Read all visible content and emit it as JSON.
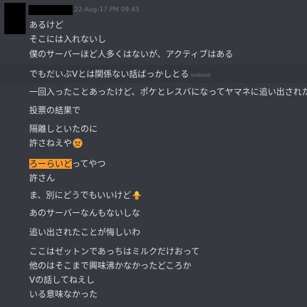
{
  "message": {
    "timestamp": "22-Aug-17 PM 09:45",
    "lines": [
      "あるけど",
      "そこには入れないし",
      "僕のサーバーほど人多くはないが、アクティブはある",
      "でもだいぶVとは関係ない話ばっかしとる",
      "一回入ったことあったけど、ポケとレスバになってヤマネに追い出された",
      "投票の結果で",
      "隔離しといたのに",
      "許さねえや",
      "ろーらいど",
      "ってやつ",
      "許さん",
      "ま、別にどうでもいいけど",
      "あのサーバーなんもないしな",
      "追い出されたことが悔しいわ",
      "ここはゼットンであっちはミルクだけおって",
      "他のはそこまで興味沸かなかったどころか",
      "Vの話してねえし",
      "いる意味なかった"
    ],
    "edited_label": "(edited)"
  },
  "emojis": {
    "angry": "angry-face-emoji",
    "shrug": "person-shrugging-emoji"
  },
  "colors": {
    "background": "#36393f",
    "text": "#dcddde",
    "muted": "#72767d",
    "highlight": "#f79a2e"
  }
}
